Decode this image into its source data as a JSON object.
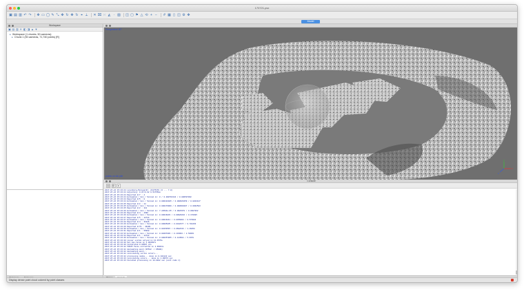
{
  "window": {
    "title": "170721.psx",
    "colors": {
      "close": "#ff5f57",
      "minimize": "#febc2e",
      "maximize": "#28c840"
    }
  },
  "toolbar": {
    "icons": [
      "new-project-icon",
      "open-icon",
      "save-icon",
      "undo-icon",
      "redo-icon",
      "navigation-icon",
      "rectangle-selection-icon",
      "circle-selection-icon",
      "free-form-selection-icon",
      "resize-region-icon",
      "move-region-icon",
      "rotate-region-icon",
      "move-object-icon",
      "rotate-object-icon",
      "move-camera-icon",
      "ruler-icon",
      "delete-selection-icon",
      "crop-selection-icon",
      "dense-cloud-icon",
      "mesh-icon",
      "point-cloud-icon",
      "textured-model-icon",
      "show-cameras-icon",
      "show-region-icon",
      "show-markers-icon",
      "show-shapes-icon",
      "reset-view-icon",
      "zoom-in-icon",
      "zoom-out-icon",
      "grid-icon",
      "bounding-box-icon",
      "orthographic-icon",
      "split-view-icon",
      "settings-icon",
      "move-icon"
    ]
  },
  "tabs": {
    "model": "Model"
  },
  "workspace": {
    "title": "Workspace",
    "tree": [
      "Workspace (1 chunks, 50 cameras)",
      "Chunk 1 (50 cameras, 71,740 points) [R]"
    ],
    "bottom_tabs": [
      "Workspace",
      "Reference"
    ]
  },
  "model_view": {
    "perspective_label": "Perspective 30°",
    "points_label": "points on ink pile",
    "axes": {
      "x": "x",
      "y": "y",
      "z": "z"
    }
  },
  "console": {
    "title": "Console",
    "tabs": [
      "Photos",
      "Console"
    ],
    "lines": [
      "2017-07-24 15:23:24 Levenberg-Marquardt: 21175470 (3 ... 7.0)",
      "2017-07-24 15:23:24 Adjusting: 0.07/0.62 9.517558a",
      "2017-07-24 15:23:24 Reported 0/7 : 4",
      "2017-07-24 15:23:24 Estimated / Gen / Solved in: 0 / 0.000761344 / 0.000507032",
      "2017-07-24 15:23:24 Reported 0/5 : 0",
      "2017-07-24 15:23:24 Estimated / Gen / Solved in: 0.000101485 / 0.000626459 / 0.0204147",
      "2017-07-24 15:23:25 Reported 0/2 : 14",
      "2017-07-24 15:23:25 Estimated / Gen / Solved in: 0.000176009 / 0.000609407 / 0.0962583",
      "2017-07-24 15:23:25 Reported 0/2 : 112",
      "2017-07-24 15:23:26 Estimated / Gen / Solved in: 7.28584e-05 / 0.0023378 / 0.0987862",
      "2017-07-24 15:23:26 Reported 0/4 : 4396",
      "2017-07-24 15:23:26 Estimated / Gen / Solved in: 0.00016833 / 0.00926216 / 0.178685",
      "2017-07-24 15:23:27 Reported 0/5 : 12744",
      "2017-07-24 15:23:27 Estimated / Gen / Solved in: 0.00016211 / 0.0456868 / 0.578982",
      "2017-07-24 15:23:28 Reported 0/4 : 31826",
      "2017-07-24 15:23:29 Estimated / Gen / Solved in: 0.00005835 / 0.0422377 / 0.781263",
      "2017-07-24 15:23:29 Reported 0/79 : 43209",
      "2017-07-24 15:23:30 Estimated / Gen / Solved in: 0.00153515 / 0.0682316 / 1.49258",
      "2017-07-24 15:23:31 Reported 0/1 : 55668",
      "2017-07-24 15:23:33 Estimated / Gen / Solved in: 0.00267893 / 0.131964 / 2.52963",
      "2017-07-24 15:23:34 Reported 0/1 : 12722",
      "2017-07-24 15:23:40 Estimated / Gen / Solved in: 0.000357865 / 0.144584 / 5.6378",
      "2017-07-24 15:23:40 Linear system solved in 11.4579s",
      "2017-07-24 15:23:40 Set 1ms-value in 5.093397s",
      "2017-07-24 15:23:40 Calibrated 0.09507 pts",
      "2017-07-24 15:23:42 53935 faces extracted in 2.99021s",
      "2017-07-24 15:23:42 decimating mesh (95512 -> 95000)",
      "2017-07-24 15:23:42 decimating mesh...",
      "2017-07-24 15:23:42 calculating vertex colors...",
      "2017-07-24 15:23:42 processing nodes... done in 0.181122 sec",
      "2017-07-24 15:23:43 calculating colors... done in 1.99573 sec",
      "2017-07-24 15:23:43 Finished processing in 18.0282 sec (exit code 1)"
    ]
  },
  "statusbar": {
    "text": "Display dense point cloud colored by point classes"
  }
}
